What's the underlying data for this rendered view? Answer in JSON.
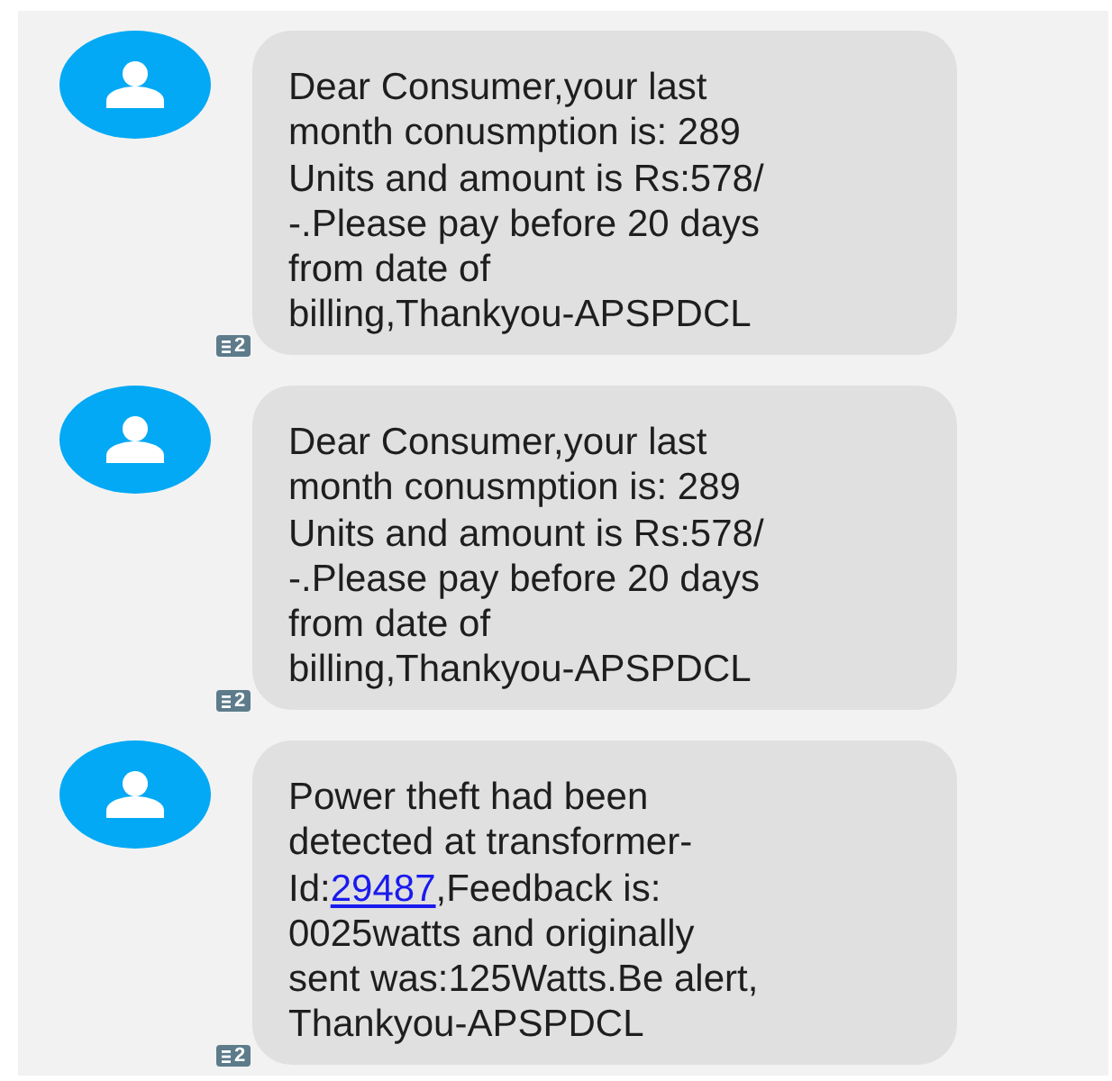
{
  "messages": [
    {
      "parts": [
        {
          "kind": "text",
          "text": "Dear Consumer,your last\nmonth conusmption is: 289\nUnits and amount is Rs:578/\n-.Please pay before 20 days\nfrom date of\nbilling,Thankyou-APSPDCL"
        }
      ],
      "sim": "2"
    },
    {
      "parts": [
        {
          "kind": "text",
          "text": "Dear Consumer,your last\nmonth conusmption is: 289\nUnits and amount is Rs:578/\n-.Please pay before 20 days\nfrom date of\nbilling,Thankyou-APSPDCL"
        }
      ],
      "sim": "2"
    },
    {
      "parts": [
        {
          "kind": "text",
          "text": "Power theft had been\ndetected at transformer-\nId:"
        },
        {
          "kind": "link",
          "text": "29487"
        },
        {
          "kind": "text",
          "text": ",Feedback is:\n0025watts and originally\nsent was:125Watts.Be alert,\nThankyou-APSPDCL"
        }
      ],
      "sim": "2"
    }
  ]
}
